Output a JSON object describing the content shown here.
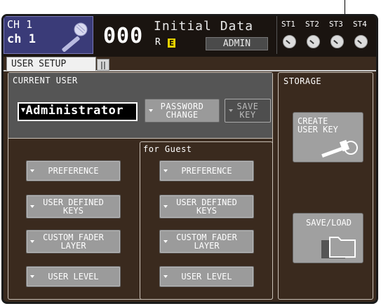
{
  "header": {
    "channel_id": "CH 1",
    "channel_name": "ch 1",
    "scene_number": "000",
    "scene_title": "Initial Data",
    "scene_flags": "R",
    "scene_flag_e": "E",
    "user_badge": "ADMIN",
    "stereo_labels": [
      "ST1",
      "ST2",
      "ST3",
      "ST4"
    ]
  },
  "tabs": {
    "active": "USER SETUP"
  },
  "current_user": {
    "label": "CURRENT USER",
    "user_select": "Administrator",
    "password_change": [
      "PASSWORD",
      "CHANGE"
    ],
    "save_key": [
      "SAVE",
      "KEY"
    ]
  },
  "guest": {
    "label": "for Guest"
  },
  "buttons": {
    "preference": "PREFERENCE",
    "user_defined_keys": [
      "USER DEFINED",
      "KEYS"
    ],
    "custom_fader_layer": [
      "CUSTOM FADER",
      "LAYER"
    ],
    "user_level": "USER LEVEL"
  },
  "storage": {
    "label": "STORAGE",
    "create_user_key": [
      "CREATE",
      "USER KEY"
    ],
    "save_load": "SAVE/LOAD"
  }
}
